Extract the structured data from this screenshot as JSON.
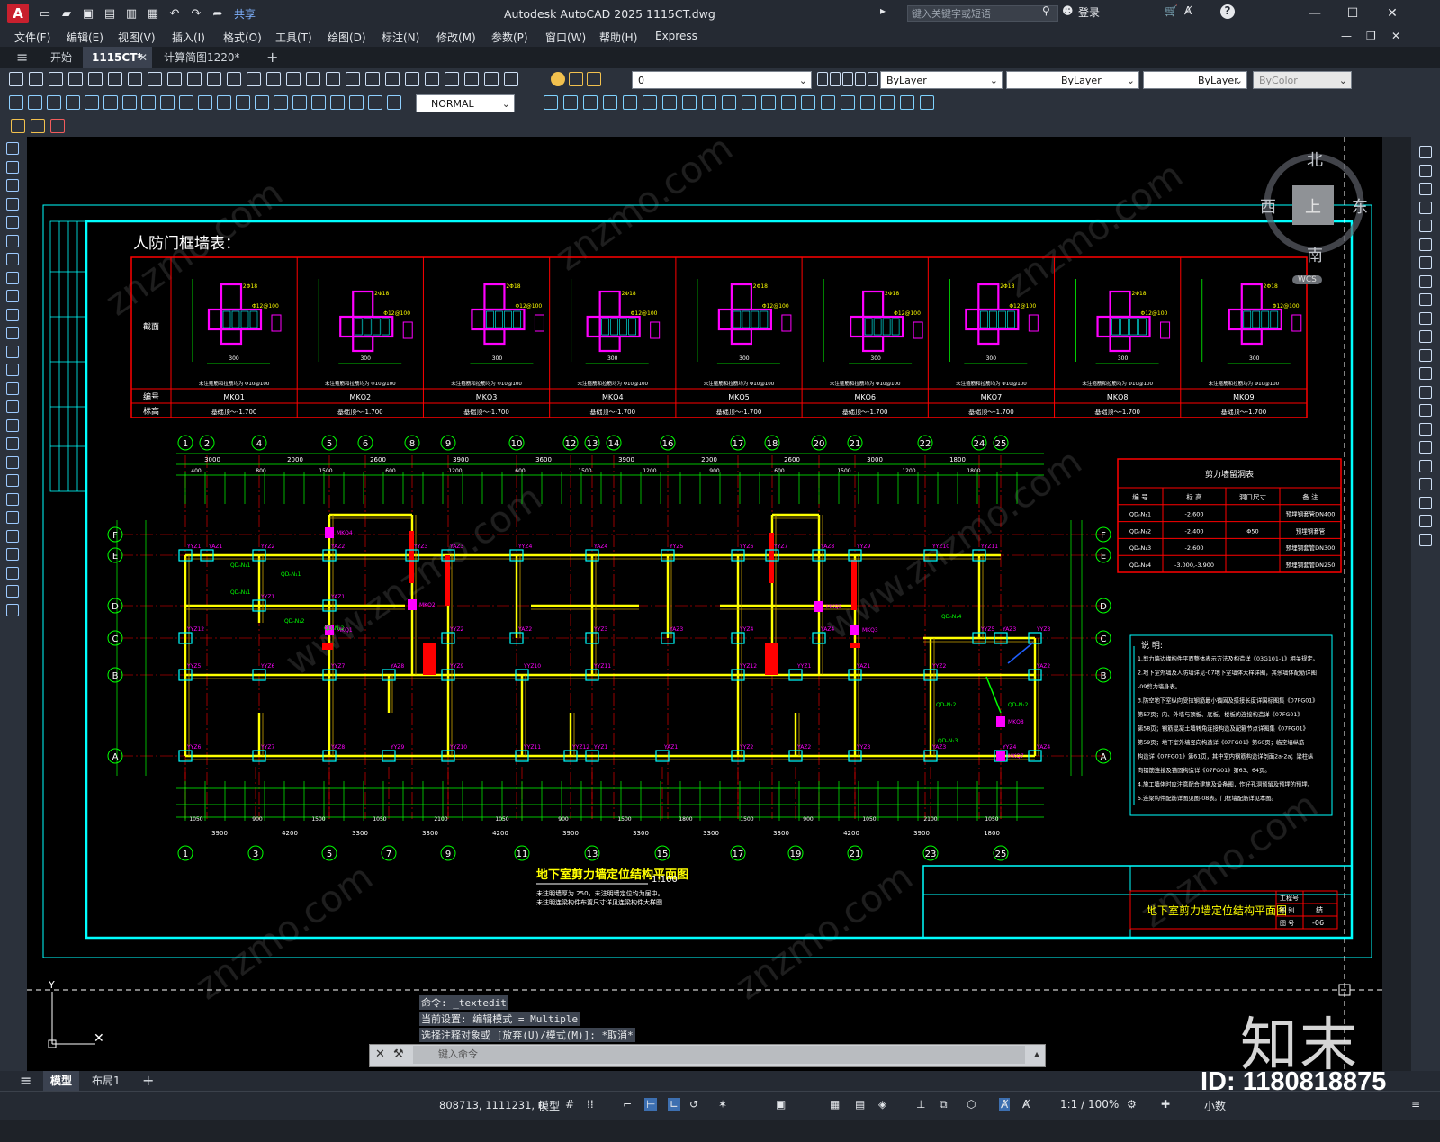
{
  "titlebar": {
    "app_icon": "A",
    "share_label": "共享",
    "window_title": "Autodesk AutoCAD 2025    1115CT.dwg",
    "search_placeholder": "键入关键字或短语",
    "login_label": "登录",
    "help_icon": "?"
  },
  "menubar": {
    "items": [
      "文件(F)",
      "编辑(E)",
      "视图(V)",
      "插入(I)",
      "格式(O)",
      "工具(T)",
      "绘图(D)",
      "标注(N)",
      "修改(M)",
      "参数(P)",
      "窗口(W)",
      "帮助(H)",
      "Express"
    ]
  },
  "filetabs": {
    "tabs": [
      "开始",
      "1115CT*",
      "计算简图1220*"
    ],
    "add_label": "+"
  },
  "toolbar": {
    "layer_value": "0",
    "color_value": "ByLayer",
    "linetype_value": "ByLayer",
    "lineweight_value": "ByLayer",
    "plotstyle_value": "ByColor",
    "dimstyle_value": "NORMAL"
  },
  "viewcube": {
    "north": "北",
    "south": "南",
    "east": "东",
    "west": "西",
    "top": "上",
    "wcs": "WCS"
  },
  "drawing": {
    "table_title": "人防门框墙表：",
    "row_labels": [
      "截面",
      "编号",
      "标高"
    ],
    "columns": [
      {
        "id": "MKQ1",
        "elev": "基础顶～-1.700",
        "note": "未注箍筋和拉筋均为 Φ10@100"
      },
      {
        "id": "MKQ2",
        "elev": "基础顶～-1.700",
        "note": "未注箍筋和拉筋均为 Φ10@100"
      },
      {
        "id": "MKQ3",
        "elev": "基础顶～-1.700",
        "note": "未注箍筋和拉筋均为 Φ10@100"
      },
      {
        "id": "MKQ4",
        "elev": "基础顶～-1.700",
        "note": "未注箍筋和拉筋均为 Φ10@100"
      },
      {
        "id": "MKQ5",
        "elev": "基础顶～-1.700",
        "note": "未注箍筋和拉筋均为 Φ10@100"
      },
      {
        "id": "MKQ6",
        "elev": "基础顶～-1.700",
        "note": "未注箍筋和拉筋均为 Φ10@100"
      },
      {
        "id": "MKQ7",
        "elev": "基础顶～-1.700",
        "note": "未注箍筋和拉筋均为 Φ10@100"
      },
      {
        "id": "MKQ8",
        "elev": "基础顶～-1.700",
        "note": "未注箍筋和拉筋均为 Φ10@100"
      },
      {
        "id": "MKQ9",
        "elev": "基础顶～-1.700",
        "note": "未注箍筋和拉筋均为 Φ10@100"
      }
    ],
    "hole_table": {
      "title": "剪力墙留洞表",
      "headers": [
        "编 号",
        "标 高",
        "洞口尺寸",
        "备 注"
      ],
      "rows": [
        [
          "QDₙN₁1",
          "-2.600",
          "",
          "预埋钢套管DN400"
        ],
        [
          "QDₙN₁2",
          "-2.400",
          "Φ50",
          "预埋钢套管"
        ],
        [
          "QDₙN₁3",
          "-2.600",
          "",
          "预埋钢套管DN300"
        ],
        [
          "QDₙN₁4",
          "-3.000,-3.900",
          "",
          "预埋钢套管DN250"
        ]
      ]
    },
    "top_axes": [
      "1",
      "2",
      "4",
      "5",
      "6",
      "8",
      "9",
      "10",
      "12",
      "13",
      "14",
      "16",
      "17",
      "18",
      "20",
      "21",
      "22",
      "24",
      "25"
    ],
    "bottom_axes": [
      "1",
      "3",
      "5",
      "7",
      "9",
      "11",
      "13",
      "15",
      "17",
      "19",
      "21",
      "23",
      "25"
    ],
    "side_axes": [
      "F",
      "E",
      "D",
      "C",
      "B",
      "A"
    ],
    "plan_title": "地下室剪力墙定位结构平面图",
    "plan_scale": "1:100",
    "plan_note1": "未注明墙厚为 250，未注明墙定位均为居中。",
    "plan_note2": "未注明连梁构件布置尺寸详见连梁构件大样图",
    "notes_title": "说 明:",
    "notes": [
      "1.剪力墙边缘构件平面整体表示方法及构造详《03G101-1》相关规定。",
      "2.地下室外墙及人防墙详见-07地下室墙体大样详图，其余墙体配筋详图",
      "-09剪力墙身表。",
      "3.防空地下室纵向受拉钢筋最小锚固及搭接长度详国标图集《07FG01》",
      "第57页；内、外墙与顶板、底板、楼板的连接构造详《07FG01》",
      "第58页；钢筋混凝土墙转角连接构造及配箍节点详图集《07FG01》",
      "第59页；地下室外墙竖向构造详《07FG01》第60页；临空墙纵筋",
      "构造详《07FG01》第61页，其中室内钢筋构造详剖面2a-2a；梁柱纵",
      "向钢筋连接及锚固构造详《07FG01》第63、64页。",
      "4.施工墙体时应注意配合建施及设备图，作好孔洞预留及预埋的预埋。",
      "5.连梁构件配筋详图见图-08表。门框墙配筋详见本图。"
    ],
    "titleblock_name": "地下室剪力墙定位结构平面图",
    "titleblock_labels": [
      "工程号",
      "图 别",
      "图 号"
    ],
    "titleblock_values": [
      "",
      "结",
      "-06"
    ]
  },
  "command": {
    "history": [
      "命令: _textedit",
      "当前设置: 编辑模式 = Multiple",
      "选择注释对象或 [放弃(U)/模式(M)]: *取消*"
    ],
    "placeholder": "键入命令"
  },
  "layouttabs": {
    "tabs": [
      "模型",
      "布局1"
    ],
    "add_label": "+"
  },
  "statusbar": {
    "coords": "808713, 1111231, 0",
    "model_label": "模型",
    "scale_label": "1:1 / 100%",
    "units_label": "小数"
  },
  "watermark": {
    "logo": "知末",
    "image_id": "ID: 1180818875"
  },
  "colors": {
    "canvas_bg": "#000000",
    "frame_cyan": "#00ffff",
    "table_red": "#ff0000",
    "wall_yellow": "#ffff00",
    "rebar_magenta": "#ff00ff",
    "dim_green": "#00ff00"
  }
}
